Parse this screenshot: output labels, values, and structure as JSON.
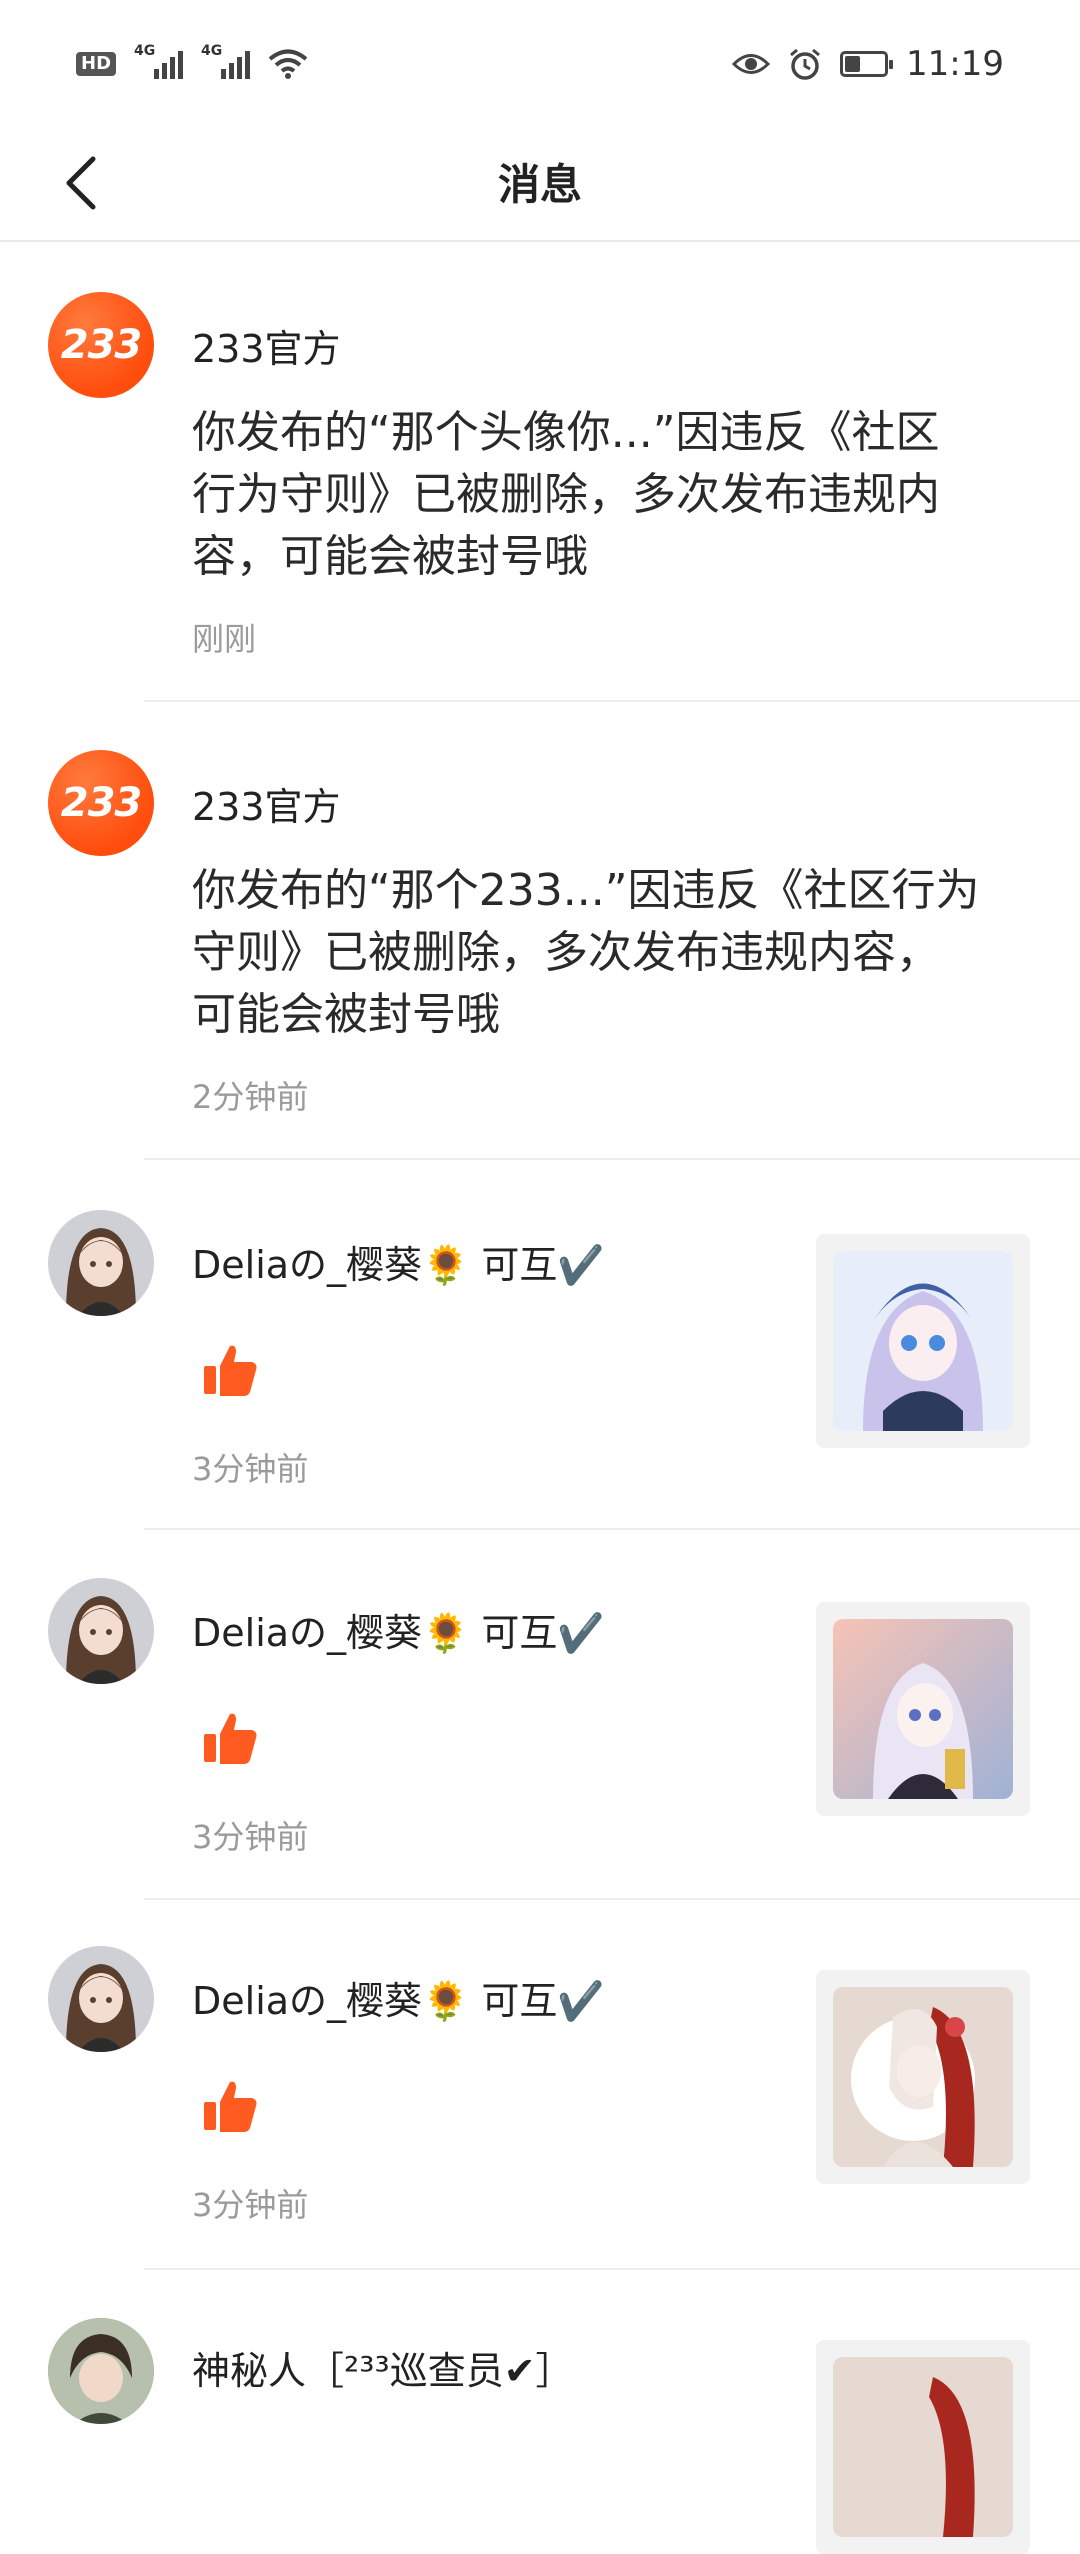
{
  "status_bar": {
    "hd_label": "HD",
    "net1": "4G",
    "net2": "4G",
    "time": "11:19",
    "battery_level": 0.4
  },
  "header": {
    "title": "消息"
  },
  "messages": [
    {
      "name": "233官方",
      "avatar_text": "233",
      "text": "你发布的“那个头像你...”因违反《社区行为守则》已被删除，多次发布违规内容，可能会被封号哦",
      "time": "刚刚"
    },
    {
      "name": "233官方",
      "avatar_text": "233",
      "text": "你发布的“那个233...”因违反《社区行为守则》已被删除，多次发布违规内容，可能会被封号哦",
      "time": "2分钟前"
    },
    {
      "name": "Deliaの_樱葵🌻 可互✔️",
      "time": "3分钟前"
    },
    {
      "name": "Deliaの_樱葵🌻 可互✔️",
      "time": "3分钟前"
    },
    {
      "name": "Deliaの_樱葵🌻 可互✔️",
      "time": "3分钟前"
    },
    {
      "name": "神秘人［²³³巡查员✔］"
    }
  ],
  "icons": {
    "back": "chevron-left-icon",
    "like": "thumbs-up-icon"
  },
  "colors": {
    "accent": "#ff5a1f",
    "like": "#ff5a1f",
    "time_text": "#9a9a9a",
    "divider": "#ededed"
  }
}
